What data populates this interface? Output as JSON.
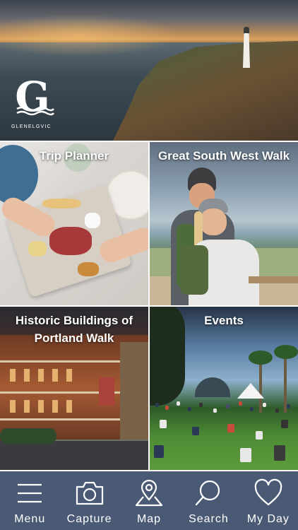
{
  "hero": {
    "logo_letter": "G",
    "logo_wordmark": "GLENELGVIC"
  },
  "tiles": [
    {
      "label": "Trip Planner"
    },
    {
      "label": "Great South West Walk"
    },
    {
      "label": "Historic Buildings of Portland Walk"
    },
    {
      "label": "Events"
    }
  ],
  "nav": {
    "items": [
      {
        "label": "Menu",
        "icon": "menu-icon"
      },
      {
        "label": "Capture",
        "icon": "camera-icon"
      },
      {
        "label": "Map",
        "icon": "map-pin-icon"
      },
      {
        "label": "Search",
        "icon": "search-icon"
      },
      {
        "label": "My Day",
        "icon": "heart-icon"
      }
    ]
  },
  "colors": {
    "nav_background": "#4a5a75",
    "tile_label": "#ffffff",
    "gap": "#ffffff"
  }
}
